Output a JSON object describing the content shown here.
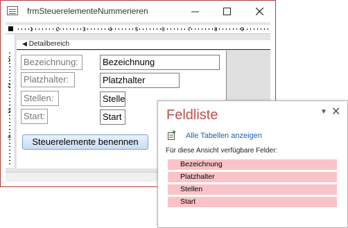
{
  "window": {
    "title": "frmSteuerelementeNummerieren",
    "accent_color": "#b13a3a"
  },
  "ruler": {
    "h_ticks": [
      "1",
      "2",
      "3",
      "4",
      "5",
      "6",
      "7",
      "8",
      "9"
    ],
    "v_ticks": [
      "1",
      "2",
      "3",
      "4"
    ]
  },
  "section": {
    "label": "Detailbereich"
  },
  "form": {
    "fields": [
      {
        "label": "Bezeichnung:",
        "value": "Bezeichnung"
      },
      {
        "label": "Platzhalter:",
        "value": "Platzhalter"
      },
      {
        "label": "Stellen:",
        "value": "Stelle"
      },
      {
        "label": "Start:",
        "value": "Start"
      }
    ],
    "button_label": "Steuerelemente benennen"
  },
  "field_list": {
    "title": "Feldliste",
    "show_all": "Alle Tabellen anzeigen",
    "available_label": "Für diese Ansicht verfügbare Felder:",
    "fields": [
      "Bezeichnung",
      "Platzhalter",
      "Stellen",
      "Start"
    ],
    "title_color": "#c0504d",
    "field_color": "#f9c3c8"
  }
}
